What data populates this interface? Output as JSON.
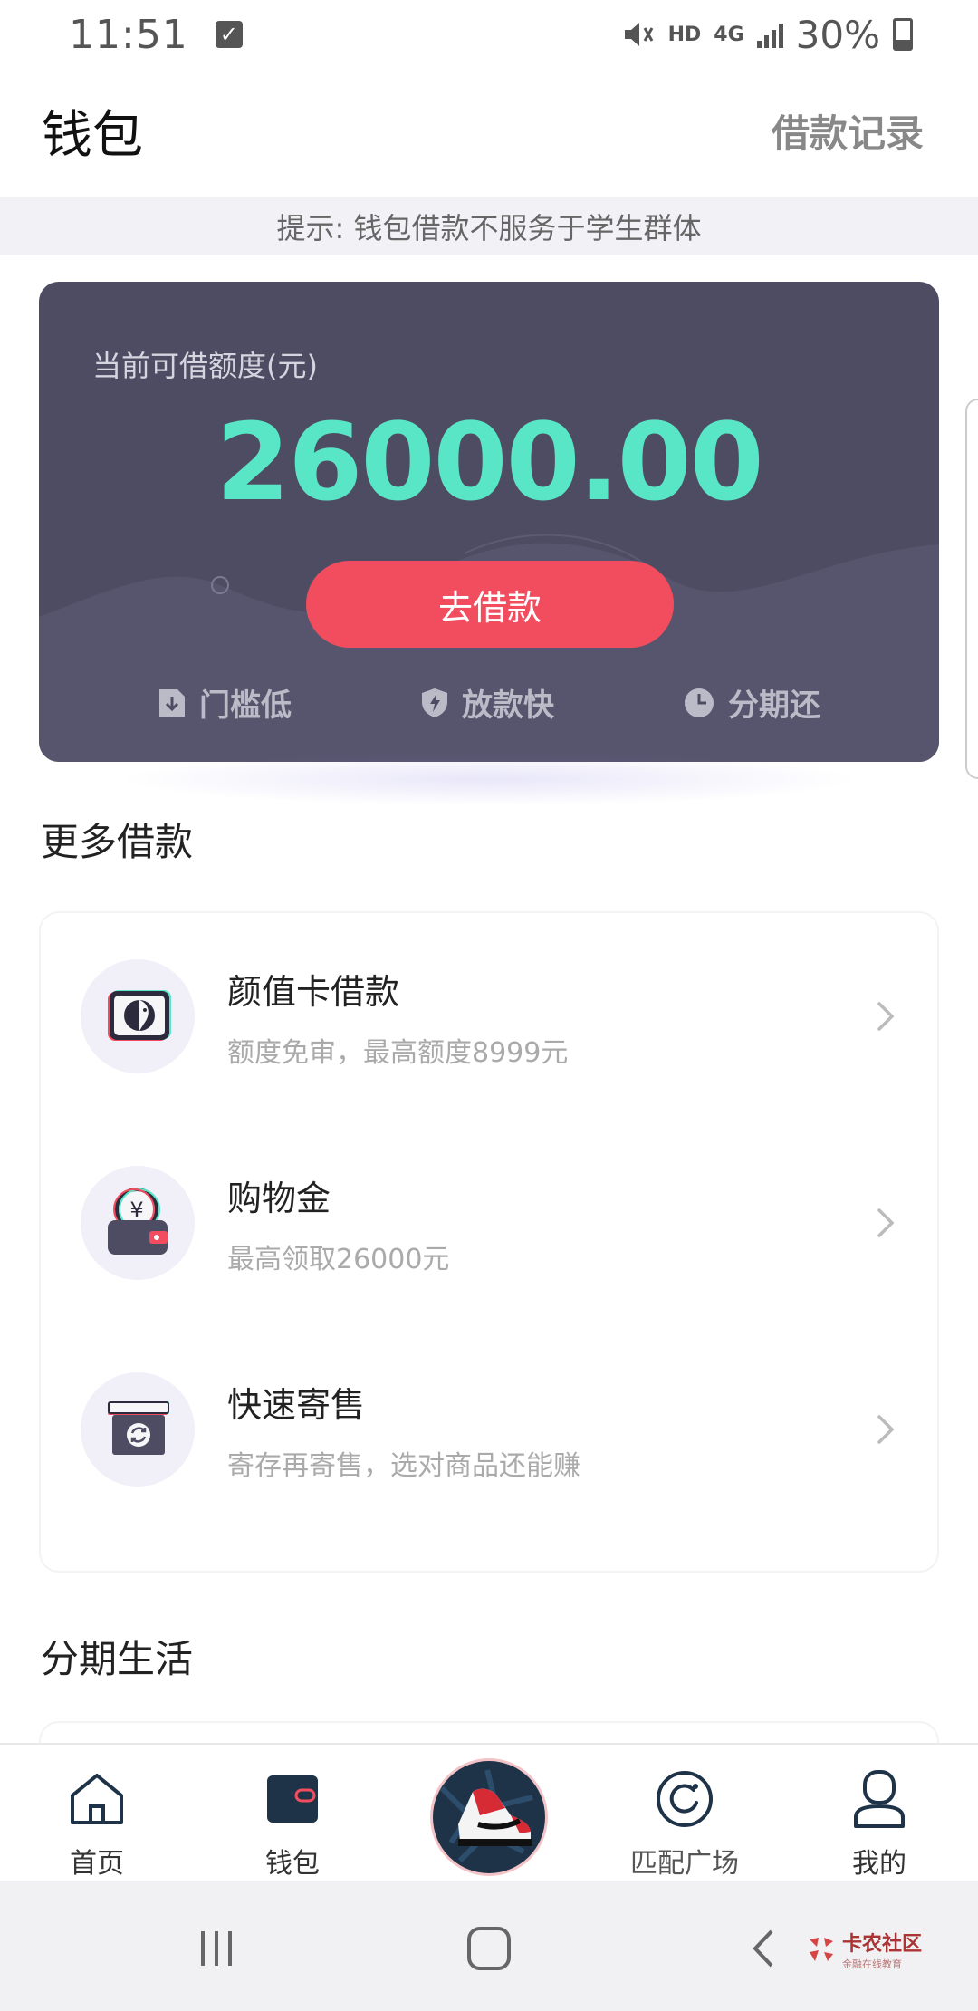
{
  "status_bar": {
    "time": "11:51",
    "hd": "HD",
    "network": "4G",
    "battery": "30%"
  },
  "header": {
    "title": "钱包",
    "records_link": "借款记录"
  },
  "notice": "提示: 钱包借款不服务于学生群体",
  "credit_card": {
    "label": "当前可借额度(元)",
    "amount": "26000.00",
    "button": "去借款",
    "features": [
      {
        "label": "门槛低",
        "icon": "download-doc-icon"
      },
      {
        "label": "放款快",
        "icon": "shield-bolt-icon"
      },
      {
        "label": "分期还",
        "icon": "clock-icon"
      }
    ],
    "colors": {
      "card": "#4e4c63",
      "amount": "#59e6c6",
      "button": "#f24d5e"
    }
  },
  "more_loans": {
    "title": "更多借款",
    "items": [
      {
        "title": "颜值卡借款",
        "subtitle": "额度免审，最高额度8999元",
        "icon": "face-card-icon"
      },
      {
        "title": "购物金",
        "subtitle": "最高领取26000元",
        "icon": "yuan-wallet-icon"
      },
      {
        "title": "快速寄售",
        "subtitle": "寄存再寄售，选对商品还能赚",
        "icon": "consign-box-icon"
      }
    ]
  },
  "installment_life": {
    "title": "分期生活"
  },
  "bottom_nav": {
    "items": [
      {
        "label": "首页",
        "icon": "home-icon"
      },
      {
        "label": "钱包",
        "icon": "wallet-icon"
      },
      {
        "label": "",
        "icon": "sneaker-icon"
      },
      {
        "label": "匹配广场",
        "icon": "match-icon"
      },
      {
        "label": "我的",
        "icon": "profile-icon"
      }
    ]
  },
  "watermark": {
    "name": "卡农社区",
    "sub": "金融在线教育"
  }
}
